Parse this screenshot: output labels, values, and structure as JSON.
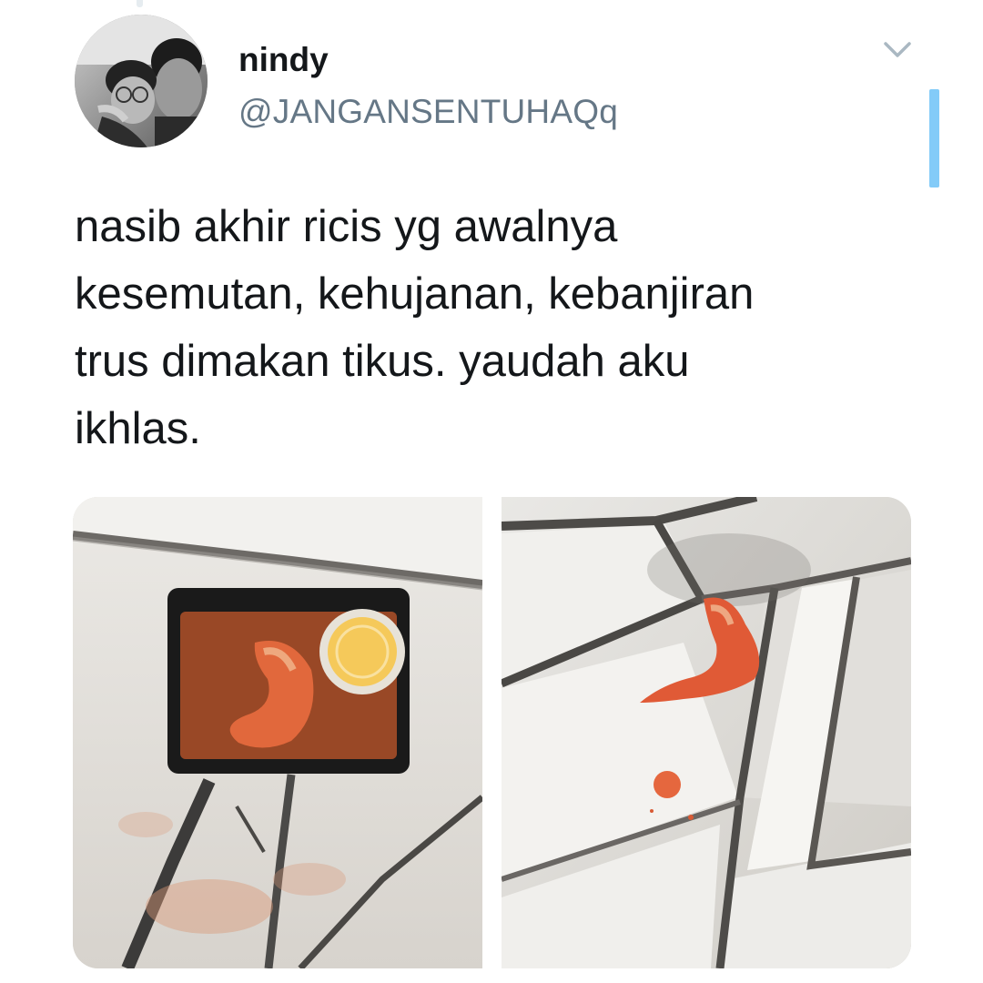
{
  "tweet": {
    "author": {
      "display_name": "nindy",
      "handle": "@JANGANSENTUHAQq"
    },
    "text": "nasib akhir ricis yg awalnya\nkesemutan, kehujanan, kebanjiran\ntrus dimakan tikus. yaudah aku\nikhlas.",
    "menu_icon": "chevron-down-icon",
    "media_count": 2
  },
  "colors": {
    "text_primary": "#14171a",
    "text_secondary": "#657786",
    "accent": "#1da1f2",
    "chevron": "#aab8c2"
  }
}
